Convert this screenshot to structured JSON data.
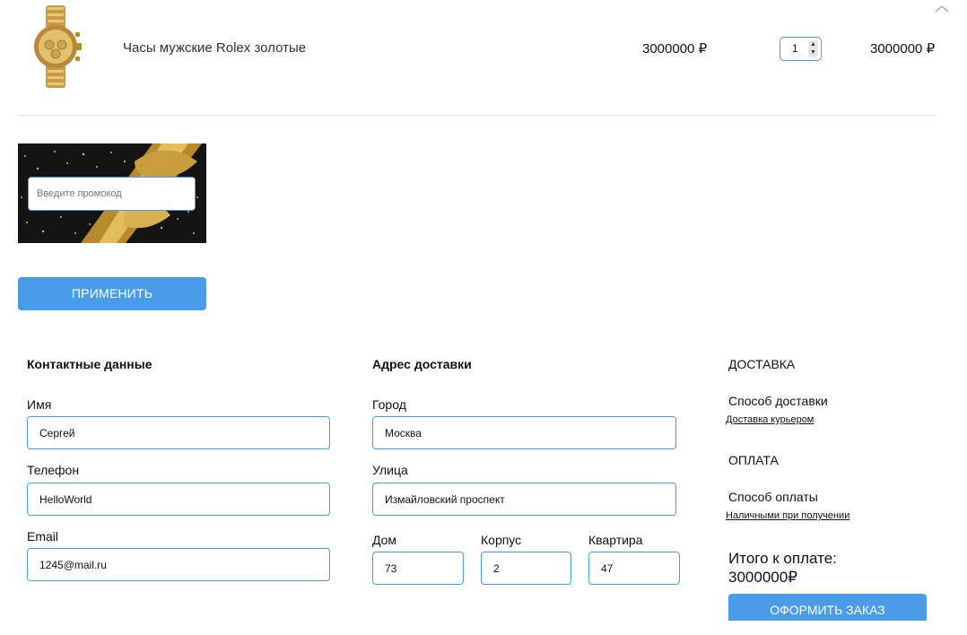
{
  "cart": {
    "item": {
      "name": "Часы мужские Rolex золотые",
      "price": "3000000 ₽",
      "quantity": "1",
      "total": "3000000 ₽",
      "image_icon": "gold-watch-image"
    },
    "collapse_icon": "chevron-up-icon"
  },
  "promo": {
    "placeholder": "Введите промокод",
    "apply_label": "ПРИМЕНИТЬ"
  },
  "contact": {
    "title": "Контактные данные",
    "name_label": "Имя",
    "name_value": "Сергей",
    "phone_label": "Телефон",
    "phone_value": "HelloWorld",
    "email_label": "Email",
    "email_value": "1245@mail.ru"
  },
  "address": {
    "title": "Адрес доставки",
    "city_label": "Город",
    "city_value": "Москва",
    "street_label": "Улица",
    "street_value": "Измайловский проспект",
    "house_label": "Дом",
    "house_value": "73",
    "building_label": "Корпус",
    "building_value": "2",
    "apartment_label": "Квартира",
    "apartment_value": "47"
  },
  "delivery": {
    "title": "ДОСТАВКА",
    "method_label": "Способ доставки",
    "method_value": "Доставка курьером"
  },
  "payment": {
    "title": "ОПЛАТА",
    "method_label": "Способ оплаты",
    "method_value": "Наличными при получении"
  },
  "summary": {
    "total_label": "Итого к оплате:",
    "total_value": "3000000₽",
    "order_label": "ОФОРМИТЬ ЗАКАЗ"
  },
  "colors": {
    "accent": "#4a9be8",
    "banner_bg": "#141414",
    "ribbon_gold": "#c9a13b"
  }
}
